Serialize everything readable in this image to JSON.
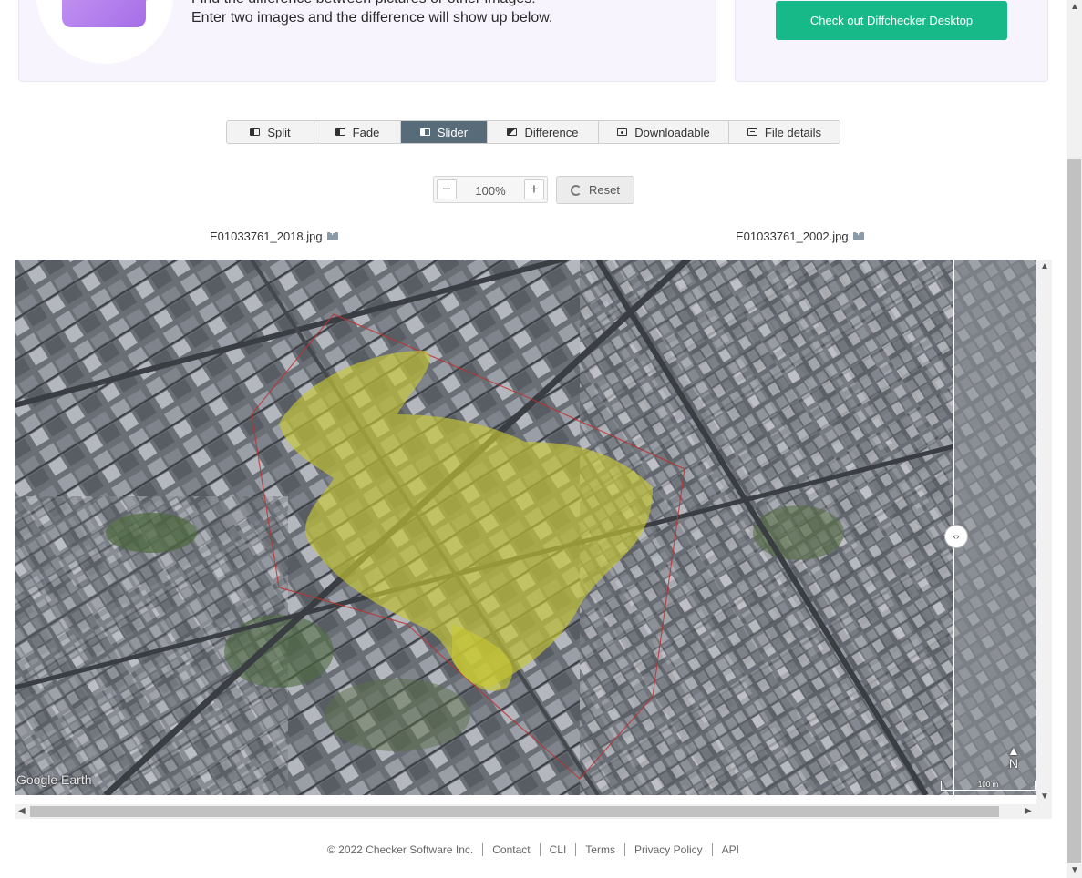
{
  "intro": {
    "line1": "Find the difference between pictures or other images!",
    "line2": "Enter two images and the difference will show up below."
  },
  "cta_label": "Check out Diffchecker Desktop",
  "tabs": [
    {
      "label": "Split",
      "icon": "split-icon",
      "active": false
    },
    {
      "label": "Fade",
      "icon": "fade-icon",
      "active": false
    },
    {
      "label": "Slider",
      "icon": "slider-icon",
      "active": true
    },
    {
      "label": "Difference",
      "icon": "difference-icon",
      "active": false
    },
    {
      "label": "Downloadable",
      "icon": "downloadable-icon",
      "active": false
    },
    {
      "label": "File details",
      "icon": "file-details-icon",
      "active": false
    }
  ],
  "zoom": {
    "minus": "−",
    "value": "100%",
    "plus": "+"
  },
  "reset_label": "Reset",
  "files": {
    "left": "E01033761_2018.jpg",
    "right": "E01033761_2002.jpg"
  },
  "map": {
    "watermark": "Google Earth",
    "north": "N",
    "scale": "100 m"
  },
  "footer": {
    "copyright": "© 2022 Checker Software Inc.",
    "links": [
      "Contact",
      "CLI",
      "Terms",
      "Privacy Policy",
      "API"
    ]
  },
  "colors": {
    "accent": "#16b987",
    "active_tab": "#586b78",
    "overlay": "#c8c832"
  }
}
